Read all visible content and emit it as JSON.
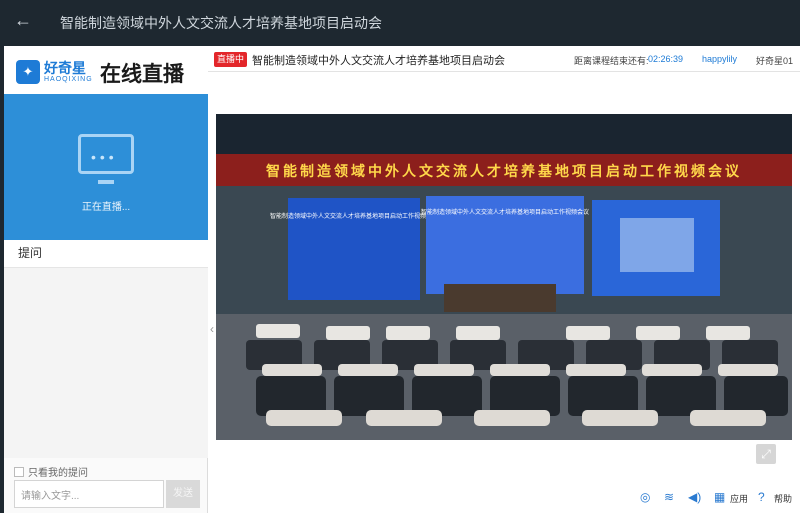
{
  "window": {
    "title": "智能制造领域中外人文交流人才培养基地项目启动会"
  },
  "logo": {
    "brand": "好奇星",
    "sub": "HAOQIXING",
    "product": "在线直播"
  },
  "live_panel": {
    "status": "正在直播..."
  },
  "ask": {
    "header": "提问",
    "only_mine": "只看我的提问",
    "placeholder": "请输入文字...",
    "send": "发送"
  },
  "main": {
    "badge": "直播中",
    "title": "智能制造领域中外人文交流人才培养基地项目启动会",
    "countdown_label": "距离课程结束还有:",
    "countdown": "02:26:39",
    "user": "happylily",
    "org": "好奇星01"
  },
  "video": {
    "banner": "智能制造领域中外人文交流人才培养基地项目启动工作视频会议",
    "left_screen_title": "智能制造领域中外人文交流人才培养基地项目启动工作视频会议",
    "center_screen_title": "智能制造领域中外人文交流人才培养基地项目启动工作视频会议"
  },
  "bottom": {
    "apps": "应用",
    "help": "帮助"
  },
  "icons": [
    "back-arrow-icon",
    "tv-icon",
    "fullscreen-icon",
    "live-icon",
    "wifi-icon",
    "volume-icon",
    "apps-grid-icon",
    "help-icon"
  ],
  "colors": {
    "accent": "#1e7bd6",
    "live_red": "#e3262a",
    "panel_blue": "#2d8fd8"
  }
}
